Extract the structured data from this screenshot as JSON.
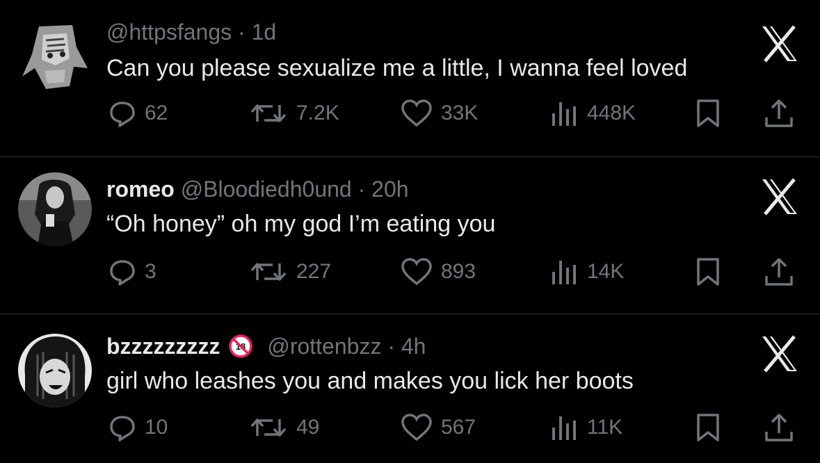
{
  "tweets": [
    {
      "display_name": "",
      "handle": "@httpsfangs",
      "time": "1d",
      "text": "Can you please sexualize me a little, I wanna feel loved",
      "replies": "62",
      "retweets": "7.2K",
      "likes": "33K",
      "views": "448K"
    },
    {
      "display_name": "romeo",
      "handle": "@Bloodiedh0und",
      "time": "20h",
      "text": "“Oh honey” oh my god I’m eating you",
      "replies": "3",
      "retweets": "227",
      "likes": "893",
      "views": "14K"
    },
    {
      "display_name": "bzzzzzzzzz",
      "badge_icon": "no-under-18-icon",
      "handle": "@rottenbzz",
      "time": "4h",
      "text": "girl who leashes you and makes you lick her boots",
      "replies": "10",
      "retweets": "49",
      "likes": "567",
      "views": "11K"
    }
  ],
  "separator": "·",
  "icons": [
    "reply-icon",
    "retweet-icon",
    "like-icon",
    "views-icon",
    "bookmark-icon",
    "share-icon",
    "x-logo-icon"
  ],
  "colors": {
    "background": "#000000",
    "text": "#e7e9ea",
    "muted": "#71767b",
    "divider": "#2f3336",
    "badge_red": "#e0245e"
  }
}
